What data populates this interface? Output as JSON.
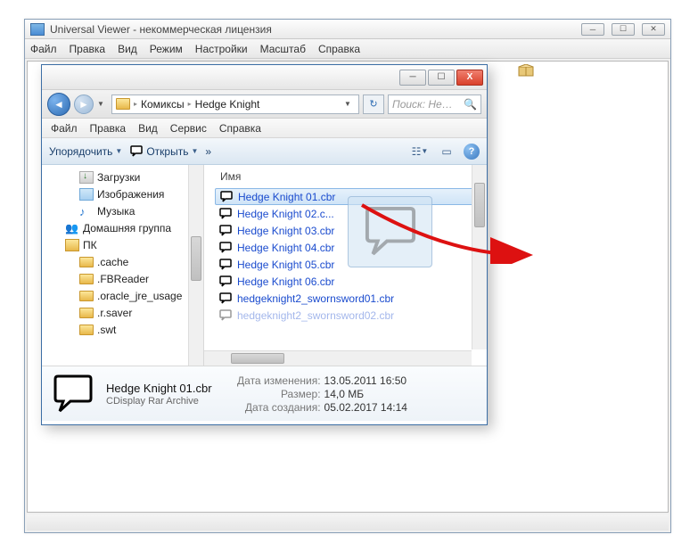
{
  "app": {
    "title": "Universal Viewer - некоммерческая лицензия",
    "menubar": [
      "Файл",
      "Правка",
      "Вид",
      "Режим",
      "Настройки",
      "Масштаб",
      "Справка"
    ]
  },
  "explorer": {
    "win_buttons": {
      "min": "─",
      "max": "☐",
      "close": "X"
    },
    "breadcrumbs": [
      "Комиксы",
      "Hedge Knight"
    ],
    "search_placeholder": "Поиск: He…",
    "menubar": [
      "Файл",
      "Правка",
      "Вид",
      "Сервис",
      "Справка"
    ],
    "toolbar": {
      "organize": "Упорядочить",
      "open": "Открыть",
      "more": "»"
    },
    "tree": [
      {
        "icon": "dl",
        "label": "Загрузки",
        "indent": 36
      },
      {
        "icon": "img",
        "label": "Изображения",
        "indent": 36
      },
      {
        "icon": "music",
        "label": "Музыка",
        "indent": 36
      },
      {
        "icon": "home",
        "label": "Домашняя группа",
        "indent": 20
      },
      {
        "icon": "pc",
        "label": "ПК",
        "indent": 20
      },
      {
        "icon": "folder",
        "label": ".cache",
        "indent": 36
      },
      {
        "icon": "folder",
        "label": ".FBReader",
        "indent": 36
      },
      {
        "icon": "folder",
        "label": ".oracle_jre_usage",
        "indent": 36
      },
      {
        "icon": "folder",
        "label": ".r.saver",
        "indent": 36
      },
      {
        "icon": "folder",
        "label": ".swt",
        "indent": 36
      }
    ],
    "column_header": "Имя",
    "files": [
      {
        "name": "Hedge Knight 01.cbr",
        "selected": true
      },
      {
        "name": "Hedge Knight 02.cbr",
        "selected": false,
        "trunc": "Hedge Knight 02.c..."
      },
      {
        "name": "Hedge Knight 03.cbr",
        "selected": false
      },
      {
        "name": "Hedge Knight 04.cbr",
        "selected": false
      },
      {
        "name": "Hedge Knight 05.cbr",
        "selected": false
      },
      {
        "name": "Hedge Knight 06.cbr",
        "selected": false
      },
      {
        "name": "hedgeknight2_swornsword01.cbr",
        "selected": false
      },
      {
        "name": "hedgeknight2_swornsword02.cbr",
        "selected": false,
        "dim": true
      }
    ],
    "details": {
      "name": "Hedge Knight 01.cbr",
      "type": "CDisplay Rar Archive",
      "modified_label": "Дата изменения:",
      "modified": "13.05.2011 16:50",
      "size_label": "Размер:",
      "size": "14,0 МБ",
      "created_label": "Дата создания:",
      "created": "05.02.2017 14:14"
    }
  }
}
